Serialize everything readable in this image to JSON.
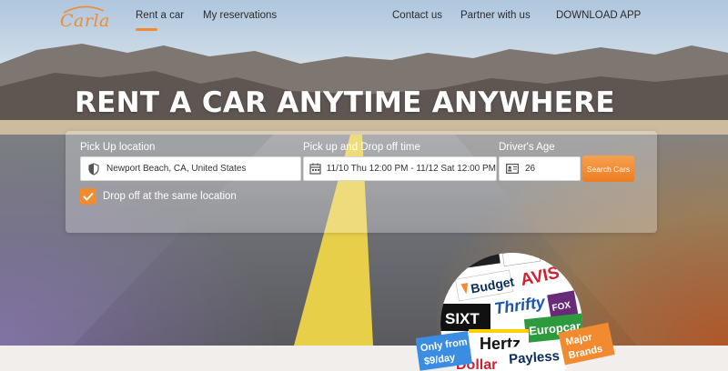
{
  "nav": {
    "logo_text": "Carla",
    "links": [
      "Rent a car",
      "My reservations",
      "Contact us",
      "Partner with us",
      "DOWNLOAD APP"
    ],
    "active_index": 0
  },
  "hero": {
    "headline": "RENT A CAR ANYTIME ANYWHERE"
  },
  "search": {
    "pickup_label": "Pick Up location",
    "pickup_value": "Newport Beach, CA, United States",
    "time_label": "Pick up and Drop off time",
    "time_value": "11/10 Thu 12:00 PM - 11/12 Sat 12:00 PM",
    "age_label": "Driver's Age",
    "age_value": "26",
    "button_label": "Search Cars",
    "same_location_label": "Drop off at the same location",
    "same_location_checked": true
  },
  "badge": {
    "brands": [
      "Budget",
      "AVIS",
      "Thrifty",
      "SIXT",
      "Europcar",
      "Hertz",
      "Payless",
      "Dollar",
      "FOX"
    ],
    "only_from_line1": "Only from",
    "only_from_line2": "$9/day",
    "major_line1": "Major",
    "major_line2": "Brands"
  },
  "colors": {
    "accent": "#f28b30",
    "avis": "#d2202f",
    "europcar": "#2e9a3e",
    "hertz_yellow": "#ffd100",
    "thrifty_blue": "#1d55a8"
  }
}
